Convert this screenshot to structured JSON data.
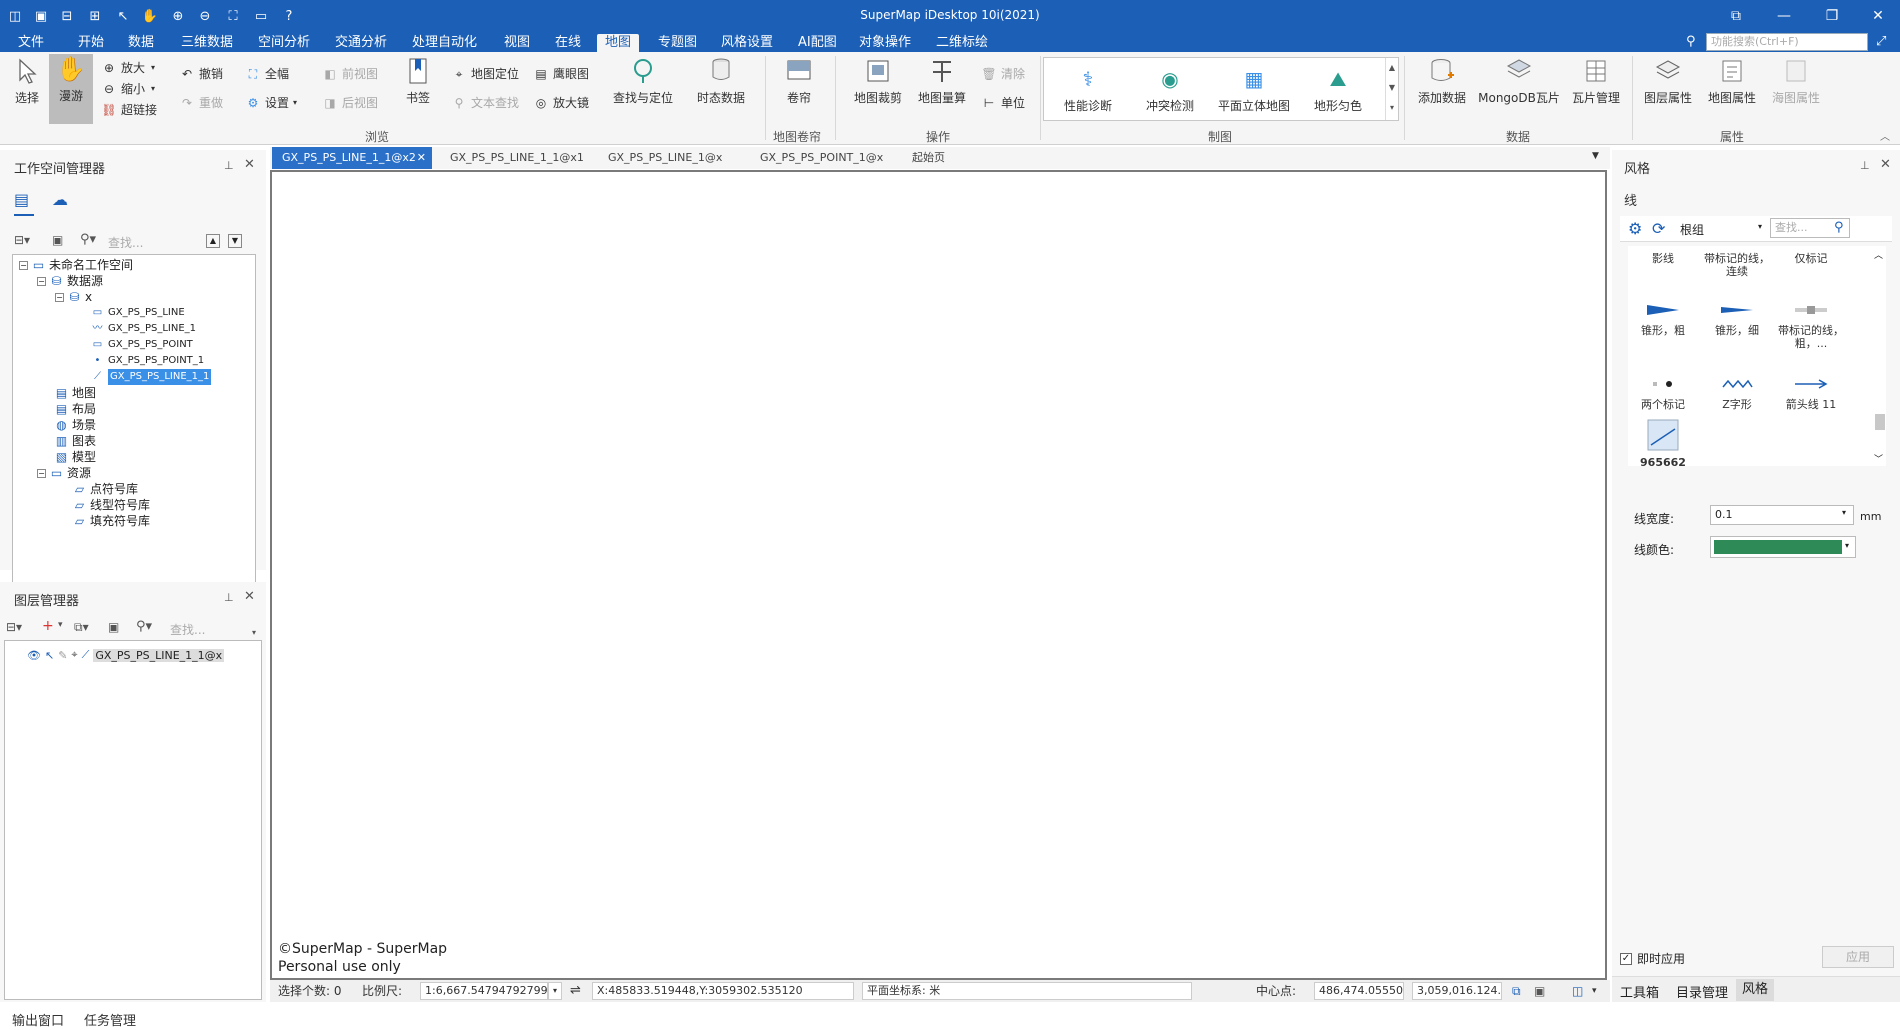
{
  "window": {
    "title": "SuperMap iDesktop 10i(2021)"
  },
  "menu": {
    "items": [
      "文件",
      "开始",
      "数据",
      "三维数据",
      "空间分析",
      "交通分析",
      "处理自动化",
      "视图",
      "在线",
      "地图",
      "专题图",
      "风格设置",
      "AI配图",
      "对象操作",
      "二维标绘"
    ],
    "active": "地图",
    "search_placeholder": "功能搜索(Ctrl+F)"
  },
  "ribbon": {
    "select": "选择",
    "pan": "漫游",
    "zoom_in": "放大",
    "zoom_out": "缩小",
    "hyperlink": "超链接",
    "undo": "撤销",
    "redo": "重做",
    "full_extent": "全幅",
    "settings": "设置",
    "prev_view": "前视图",
    "next_view": "后视图",
    "bookmark": "书签",
    "map_locate": "地图定位",
    "text_find": "文本查找",
    "overview": "鹰眼图",
    "magnifier": "放大镜",
    "find_locate": "查找与定位",
    "temporal": "时态数据",
    "group_browse": "浏览",
    "swipe": "卷帘",
    "group_swipe": "地图卷帘",
    "map_clip": "地图裁剪",
    "map_measure": "地图量算",
    "clear": "清除",
    "unit": "单位",
    "group_ops": "操作",
    "perf_diag": "性能诊断",
    "conflict": "冲突检测",
    "plane3d": "平面立体地图",
    "terrain_color": "地形匀色",
    "group_cartography": "制图",
    "add_data": "添加数据",
    "mongodb_tile": "MongoDB瓦片",
    "tile_mgmt": "瓦片管理",
    "group_data": "数据",
    "layer_props": "图层属性",
    "map_props": "地图属性",
    "chart_props": "海图属性",
    "group_props": "属性"
  },
  "workspace": {
    "title": "工作空间管理器",
    "search_placeholder": "查找...",
    "root": "未命名工作空间",
    "datasources": "数据源",
    "ds_name": "x",
    "datasets": [
      "GX_PS_PS_LINE",
      "GX_PS_PS_LINE_1",
      "GX_PS_PS_POINT",
      "GX_PS_PS_POINT_1",
      "GX_PS_PS_LINE_1_1"
    ],
    "maps": "地图",
    "layouts": "布局",
    "scenes": "场景",
    "charts": "图表",
    "models": "模型",
    "resources": "资源",
    "res_items": [
      "点符号库",
      "线型符号库",
      "填充符号库"
    ]
  },
  "layers": {
    "title": "图层管理器",
    "search_placeholder": "查找...",
    "layer_name": "GX_PS_PS_LINE_1_1@x"
  },
  "tabs": {
    "items": [
      "GX_PS_PS_LINE_1_1@x2",
      "GX_PS_PS_LINE_1_1@x1",
      "GX_PS_PS_LINE_1@x",
      "GX_PS_PS_POINT_1@x",
      "起始页"
    ]
  },
  "map": {
    "copyright_1": "©SuperMap - SuperMap",
    "copyright_2": "Personal use only"
  },
  "status": {
    "selected_label": "选择个数: 0",
    "scale_label": "比例尺:",
    "scale_value": "1:6,667.54794792799",
    "coords": "X:485833.519448,Y:3059302.535120",
    "crs": "平面坐标系: 米",
    "center_label": "中心点:",
    "center_x": "486,474.055500",
    "center_y": "3,059,016.124..."
  },
  "bottom_tabs": [
    "输出窗口",
    "任务管理"
  ],
  "style_panel": {
    "title": "风格",
    "section": "线",
    "group": "根组",
    "search_placeholder": "查找...",
    "symbols": [
      {
        "label": "影线",
        "icon": "hatch-line-icon"
      },
      {
        "label": "带标记的线，连续",
        "icon": "marked-line-icon"
      },
      {
        "label": "仅标记",
        "icon": "marker-only-icon"
      },
      {
        "label": "锥形，粗",
        "icon": "taper-thick-icon"
      },
      {
        "label": "锥形，细",
        "icon": "taper-thin-icon"
      },
      {
        "label": "带标记的线，粗，...",
        "icon": "marked-thick-icon"
      },
      {
        "label": "两个标记",
        "icon": "two-markers-icon"
      },
      {
        "label": "Z字形",
        "icon": "zigzag-icon"
      },
      {
        "label": "箭头线 11",
        "icon": "arrow-line-icon"
      },
      {
        "label": "965662",
        "icon": "custom-line-icon"
      }
    ],
    "width_label": "线宽度:",
    "width_value": "0.1",
    "width_unit": "mm",
    "color_label": "线颜色:",
    "line_color": "#2e8b57",
    "instant_apply": "即时应用",
    "apply": "应用",
    "bottom_tabs": [
      "工具箱",
      "目录管理",
      "风格"
    ]
  },
  "colors": {
    "brand": "#1b5fb6",
    "tab_active": "#2a70c9",
    "selection": "#3a8fe6"
  }
}
